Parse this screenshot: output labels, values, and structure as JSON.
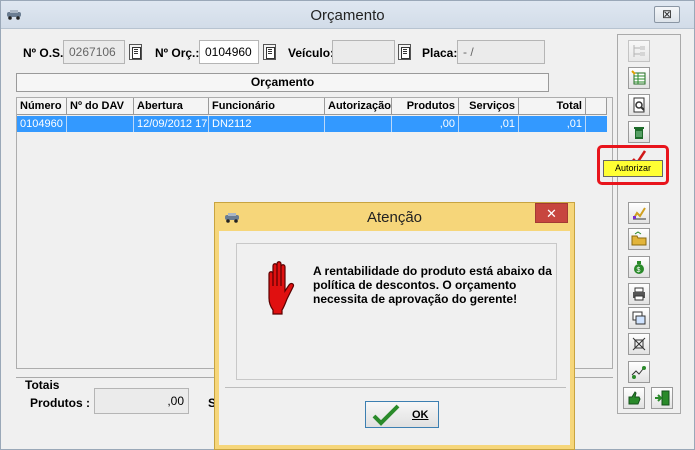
{
  "window": {
    "title": "Orçamento",
    "close_label": "⊠"
  },
  "header": {
    "os_label": "Nº O.S.:",
    "os_value": "0267106",
    "orc_label": "Nº Orç.:",
    "orc_value": "0104960",
    "veiculo_label": "Veículo:",
    "veiculo_value": "",
    "placa_label": "Placa:",
    "placa_value": " -  /"
  },
  "section": {
    "label": "Orçamento"
  },
  "grid": {
    "columns": [
      "Número",
      "Nº do DAV",
      "Abertura",
      "Funcionário",
      "Autorização",
      "Produtos",
      "Serviços",
      "Total"
    ],
    "rows": [
      [
        "0104960",
        "",
        "12/09/2012  17:",
        "DN2112",
        "",
        ",00",
        ",01",
        ",01"
      ]
    ]
  },
  "totais": {
    "title": "Totais",
    "produtos_label": "Produtos :",
    "produtos_value": ",00",
    "servicos_label_partial": "S"
  },
  "toolbar": {
    "tooltip": "Autorizar",
    "buttons": [
      "tree-view-icon",
      "grid-list-icon",
      "search-document-icon",
      "trash-icon",
      "authorize-check-icon",
      "chart-icon",
      "folder-open-icon",
      "money-bag-icon",
      "printer-icon",
      "copy-windows-icon",
      "split-icon",
      "transfer-icon",
      "thumb-icon",
      "exit-door-icon"
    ]
  },
  "dialog": {
    "title": "Atenção",
    "close_label": "✕",
    "message": "A rentabilidade do produto está abaixo da política de descontos. O orçamento necessita de aprovação do gerente!",
    "ok_label": "OK"
  },
  "colors": {
    "selection": "#3399ff",
    "dialog_title": "#f6d67a",
    "highlight": "#e8141c",
    "tooltip": "#ffff33"
  }
}
